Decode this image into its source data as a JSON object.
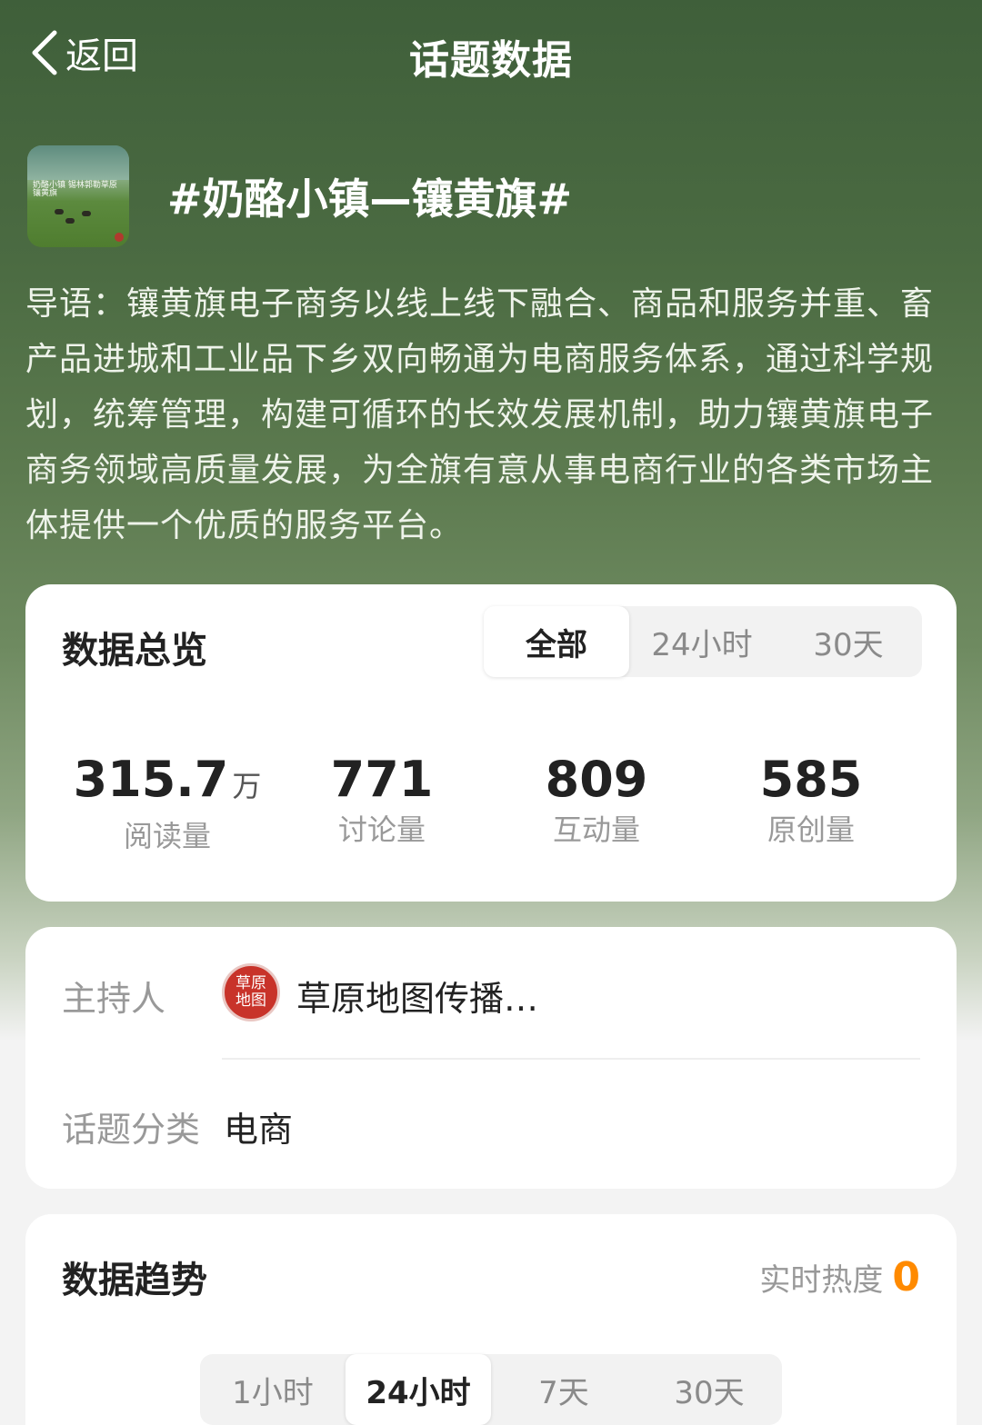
{
  "header": {
    "back_label": "返回",
    "title": "话题数据"
  },
  "topic": {
    "thumbnail_text": "奶酪小镇 锡林郭勒草原镶黄旗",
    "title": "#奶酪小镇—镶黄旗#",
    "intro": "导语：镶黄旗电子商务以线上线下融合、商品和服务并重、畜产品进城和工业品下乡双向畅通为电商服务体系，通过科学规划，统筹管理，构建可循环的长效发展机制，助力镶黄旗电子商务领域高质量发展，为全旗有意从事电商行业的各类市场主体提供一个优质的服务平台。"
  },
  "overview": {
    "title": "数据总览",
    "tabs": [
      "全部",
      "24小时",
      "30天"
    ],
    "active_tab": "全部",
    "stats": [
      {
        "value": "315.7",
        "unit": "万",
        "label": "阅读量"
      },
      {
        "value": "771",
        "unit": "",
        "label": "讨论量"
      },
      {
        "value": "809",
        "unit": "",
        "label": "互动量"
      },
      {
        "value": "585",
        "unit": "",
        "label": "原创量"
      }
    ]
  },
  "info": {
    "host_label": "主持人",
    "host_avatar_text": "草原地图",
    "host_name": "草原地图传播…",
    "category_label": "话题分类",
    "category_value": "电商"
  },
  "trend": {
    "title": "数据趋势",
    "heat_label": "实时热度",
    "heat_value": "0",
    "tabs": [
      "1小时",
      "24小时",
      "7天",
      "30天"
    ],
    "active_tab": "24小时"
  },
  "colors": {
    "accent": "#ff8a00",
    "hero_green": "#4b6b42",
    "seal_red": "#c8332a"
  }
}
